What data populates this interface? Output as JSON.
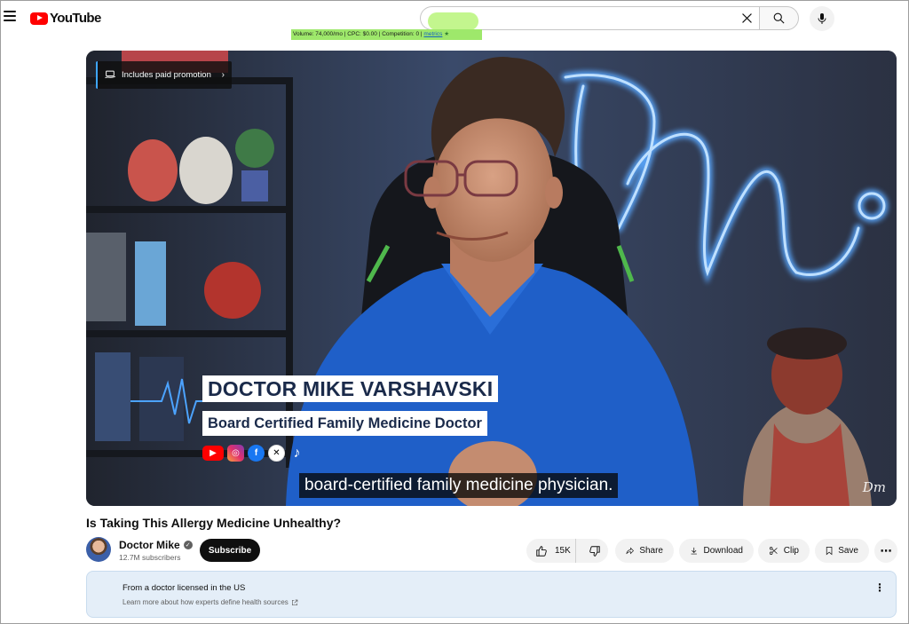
{
  "header": {
    "logo_text": "YouTube",
    "search": {
      "value": "",
      "placeholder": ""
    },
    "seo_extension": {
      "text": "Volume: 74,000/mo | CPC: $0.00 | Competition: 0 | ",
      "link_text": "metrics",
      "star": "★"
    }
  },
  "video": {
    "promo_badge": "Includes paid promotion",
    "lower_third_name": "DOCTOR MIKE VARSHAVSKI",
    "lower_third_title": "Board Certified Family Medicine Doctor",
    "social_icons": [
      "youtube-icon",
      "instagram-icon",
      "facebook-icon",
      "x-icon",
      "tiktok-icon"
    ],
    "caption": "board-certified family medicine physician.",
    "watermark": "Dm",
    "title": "Is Taking This Allergy Medicine Unhealthy?"
  },
  "channel": {
    "name": "Doctor Mike",
    "subscribers": "12.7M subscribers",
    "subscribe_label": "Subscribe"
  },
  "actions": {
    "like_count": "15K",
    "share_label": "Share",
    "download_label": "Download",
    "clip_label": "Clip",
    "save_label": "Save"
  },
  "health_panel": {
    "title": "From a doctor licensed in the US",
    "link": "Learn more about how experts define health sources"
  },
  "colors": {
    "brand_red": "#ff0000",
    "neon_sign": "#5aa8ff",
    "shirt_blue": "#1f5fc8",
    "panel_bg": "#e4eef8",
    "seo_green": "#9ee86b"
  }
}
